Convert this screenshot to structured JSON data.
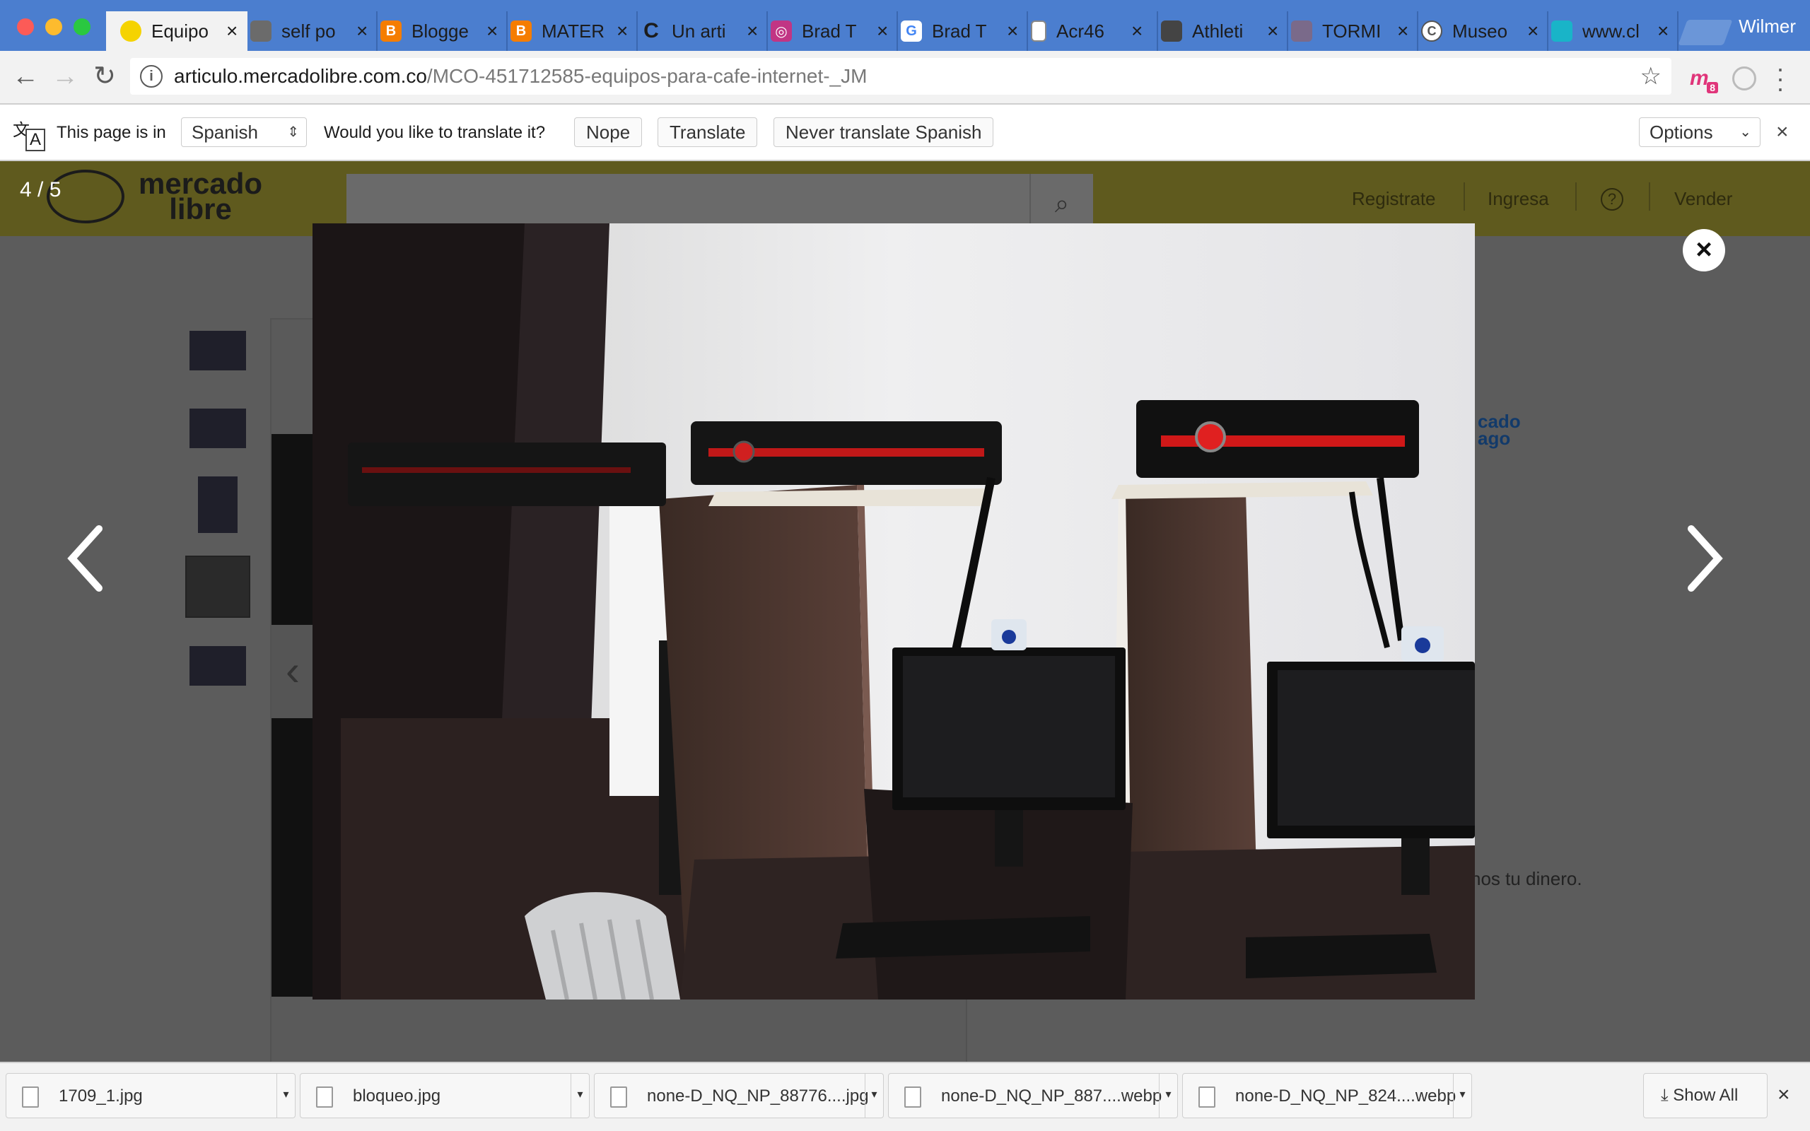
{
  "browser": {
    "profile_name": "Wilmer",
    "tabs": [
      {
        "title": "Equipo",
        "favicon": "mercadolibre-icon",
        "color": "#f5d300"
      },
      {
        "title": "self po",
        "favicon": "image-icon",
        "color": "#6b6b6b"
      },
      {
        "title": "Blogge",
        "favicon": "blogger-icon",
        "color": "#f57d00"
      },
      {
        "title": "MATER",
        "favicon": "blogger-icon",
        "color": "#f57d00"
      },
      {
        "title": "Un arti",
        "favicon": "c-icon",
        "color": "#1c1c1c"
      },
      {
        "title": "Brad T",
        "favicon": "instagram-icon",
        "color": "#c13584"
      },
      {
        "title": "Brad T",
        "favicon": "google-icon",
        "color": "#4285f4"
      },
      {
        "title": "Acr46",
        "favicon": "file-icon",
        "color": "#888888"
      },
      {
        "title": "Athleti",
        "favicon": "image-icon",
        "color": "#444444"
      },
      {
        "title": "TORMI",
        "favicon": "image-icon",
        "color": "#7a6a8a"
      },
      {
        "title": "Museo",
        "favicon": "copyright-icon",
        "color": "#555555"
      },
      {
        "title": "www.cl",
        "favicon": "image-icon",
        "color": "#19b4c8"
      }
    ],
    "url_host": "articulo.mercadolibre.com.co",
    "url_path": "/MCO-451712585-equipos-para-cafe-internet-_JM",
    "extension_badge": "8"
  },
  "translate_bar": {
    "prefix": "This page is in",
    "language": "Spanish",
    "question": "Would you like to translate it?",
    "nope": "Nope",
    "translate": "Translate",
    "never": "Never translate Spanish",
    "options": "Options"
  },
  "site": {
    "logo_line1": "mercado",
    "logo_line2": "libre",
    "nav": {
      "register": "Registrate",
      "login": "Ingresa",
      "help": "?",
      "sell": "Vender"
    },
    "side_logo_1": "cado",
    "side_logo_2": "ago",
    "side_text": "nos tu dinero."
  },
  "lightbox": {
    "counter": "4 / 5",
    "close": "×"
  },
  "downloads": {
    "items": [
      {
        "name": "1709_1.jpg"
      },
      {
        "name": "bloqueo.jpg"
      },
      {
        "name": "none-D_NQ_NP_88776....jpg"
      },
      {
        "name": "none-D_NQ_NP_887....webp"
      },
      {
        "name": "none-D_NQ_NP_824....webp"
      }
    ],
    "show_all": "Show All"
  }
}
